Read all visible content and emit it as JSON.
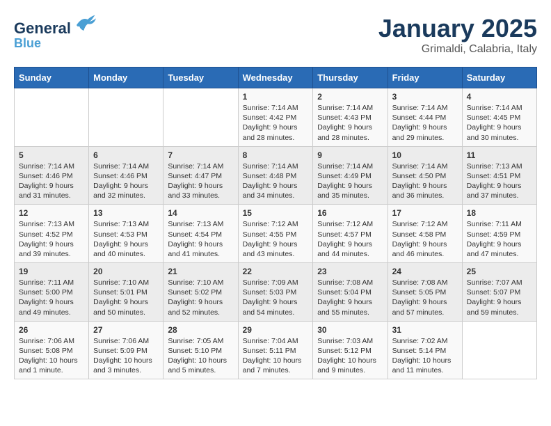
{
  "header": {
    "logo_line1": "General",
    "logo_line2": "Blue",
    "title": "January 2025",
    "subtitle": "Grimaldi, Calabria, Italy"
  },
  "weekdays": [
    "Sunday",
    "Monday",
    "Tuesday",
    "Wednesday",
    "Thursday",
    "Friday",
    "Saturday"
  ],
  "weeks": [
    [
      {
        "day": "",
        "text": ""
      },
      {
        "day": "",
        "text": ""
      },
      {
        "day": "",
        "text": ""
      },
      {
        "day": "1",
        "text": "Sunrise: 7:14 AM\nSunset: 4:42 PM\nDaylight: 9 hours and 28 minutes."
      },
      {
        "day": "2",
        "text": "Sunrise: 7:14 AM\nSunset: 4:43 PM\nDaylight: 9 hours and 28 minutes."
      },
      {
        "day": "3",
        "text": "Sunrise: 7:14 AM\nSunset: 4:44 PM\nDaylight: 9 hours and 29 minutes."
      },
      {
        "day": "4",
        "text": "Sunrise: 7:14 AM\nSunset: 4:45 PM\nDaylight: 9 hours and 30 minutes."
      }
    ],
    [
      {
        "day": "5",
        "text": "Sunrise: 7:14 AM\nSunset: 4:46 PM\nDaylight: 9 hours and 31 minutes."
      },
      {
        "day": "6",
        "text": "Sunrise: 7:14 AM\nSunset: 4:46 PM\nDaylight: 9 hours and 32 minutes."
      },
      {
        "day": "7",
        "text": "Sunrise: 7:14 AM\nSunset: 4:47 PM\nDaylight: 9 hours and 33 minutes."
      },
      {
        "day": "8",
        "text": "Sunrise: 7:14 AM\nSunset: 4:48 PM\nDaylight: 9 hours and 34 minutes."
      },
      {
        "day": "9",
        "text": "Sunrise: 7:14 AM\nSunset: 4:49 PM\nDaylight: 9 hours and 35 minutes."
      },
      {
        "day": "10",
        "text": "Sunrise: 7:14 AM\nSunset: 4:50 PM\nDaylight: 9 hours and 36 minutes."
      },
      {
        "day": "11",
        "text": "Sunrise: 7:13 AM\nSunset: 4:51 PM\nDaylight: 9 hours and 37 minutes."
      }
    ],
    [
      {
        "day": "12",
        "text": "Sunrise: 7:13 AM\nSunset: 4:52 PM\nDaylight: 9 hours and 39 minutes."
      },
      {
        "day": "13",
        "text": "Sunrise: 7:13 AM\nSunset: 4:53 PM\nDaylight: 9 hours and 40 minutes."
      },
      {
        "day": "14",
        "text": "Sunrise: 7:13 AM\nSunset: 4:54 PM\nDaylight: 9 hours and 41 minutes."
      },
      {
        "day": "15",
        "text": "Sunrise: 7:12 AM\nSunset: 4:55 PM\nDaylight: 9 hours and 43 minutes."
      },
      {
        "day": "16",
        "text": "Sunrise: 7:12 AM\nSunset: 4:57 PM\nDaylight: 9 hours and 44 minutes."
      },
      {
        "day": "17",
        "text": "Sunrise: 7:12 AM\nSunset: 4:58 PM\nDaylight: 9 hours and 46 minutes."
      },
      {
        "day": "18",
        "text": "Sunrise: 7:11 AM\nSunset: 4:59 PM\nDaylight: 9 hours and 47 minutes."
      }
    ],
    [
      {
        "day": "19",
        "text": "Sunrise: 7:11 AM\nSunset: 5:00 PM\nDaylight: 9 hours and 49 minutes."
      },
      {
        "day": "20",
        "text": "Sunrise: 7:10 AM\nSunset: 5:01 PM\nDaylight: 9 hours and 50 minutes."
      },
      {
        "day": "21",
        "text": "Sunrise: 7:10 AM\nSunset: 5:02 PM\nDaylight: 9 hours and 52 minutes."
      },
      {
        "day": "22",
        "text": "Sunrise: 7:09 AM\nSunset: 5:03 PM\nDaylight: 9 hours and 54 minutes."
      },
      {
        "day": "23",
        "text": "Sunrise: 7:08 AM\nSunset: 5:04 PM\nDaylight: 9 hours and 55 minutes."
      },
      {
        "day": "24",
        "text": "Sunrise: 7:08 AM\nSunset: 5:05 PM\nDaylight: 9 hours and 57 minutes."
      },
      {
        "day": "25",
        "text": "Sunrise: 7:07 AM\nSunset: 5:07 PM\nDaylight: 9 hours and 59 minutes."
      }
    ],
    [
      {
        "day": "26",
        "text": "Sunrise: 7:06 AM\nSunset: 5:08 PM\nDaylight: 10 hours and 1 minute."
      },
      {
        "day": "27",
        "text": "Sunrise: 7:06 AM\nSunset: 5:09 PM\nDaylight: 10 hours and 3 minutes."
      },
      {
        "day": "28",
        "text": "Sunrise: 7:05 AM\nSunset: 5:10 PM\nDaylight: 10 hours and 5 minutes."
      },
      {
        "day": "29",
        "text": "Sunrise: 7:04 AM\nSunset: 5:11 PM\nDaylight: 10 hours and 7 minutes."
      },
      {
        "day": "30",
        "text": "Sunrise: 7:03 AM\nSunset: 5:12 PM\nDaylight: 10 hours and 9 minutes."
      },
      {
        "day": "31",
        "text": "Sunrise: 7:02 AM\nSunset: 5:14 PM\nDaylight: 10 hours and 11 minutes."
      },
      {
        "day": "",
        "text": ""
      }
    ]
  ]
}
